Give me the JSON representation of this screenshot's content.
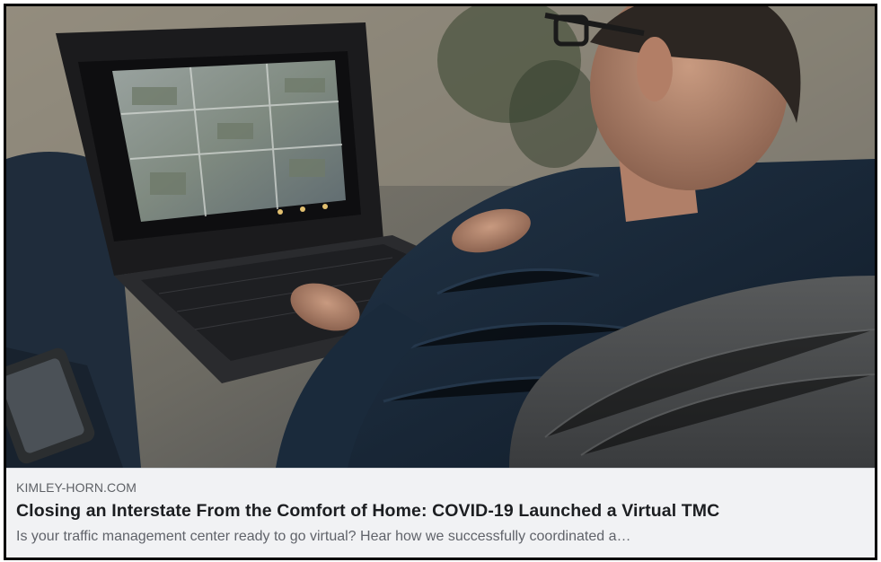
{
  "link_preview": {
    "domain": "KIMLEY-HORN.COM",
    "title": "Closing an Interstate From the Comfort of Home: COVID-19 Launched a Virtual TMC",
    "description": "Is your traffic management center ready to go virtual? Hear how we successfully coordinated a…",
    "image": {
      "icon": "photo-man-laptop-traffic-cameras"
    }
  },
  "colors": {
    "meta_background": "#f1f2f4",
    "title_text": "#1c1e21",
    "secondary_text": "#60636a",
    "card_border": "#000000"
  }
}
